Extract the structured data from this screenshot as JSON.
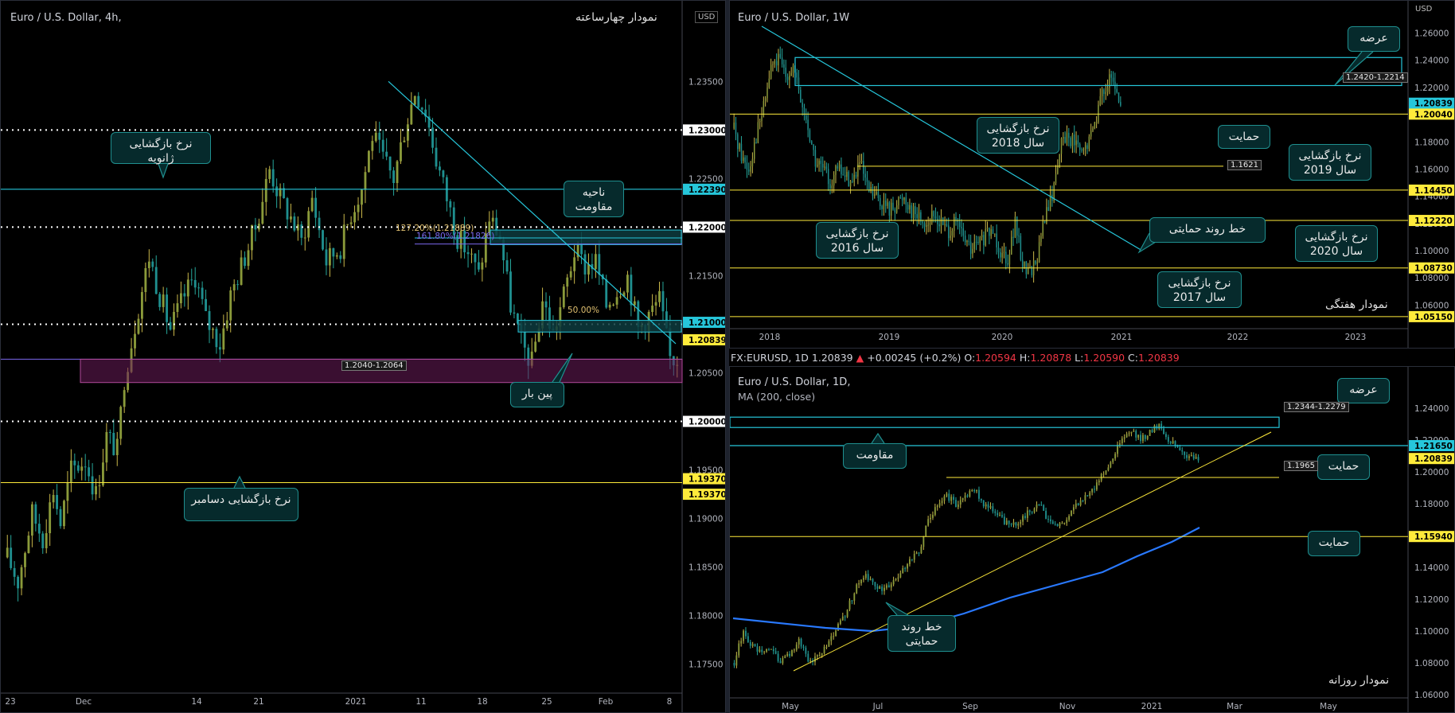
{
  "topbar": {
    "symbol": "FX:EURUSD, 1D",
    "last": "1.20839",
    "arrow": "▲",
    "change": "+0.00245 (+0.2%)",
    "open_label": "O:",
    "open": "1.20594",
    "high_label": "H:",
    "high": "1.20878",
    "low_label": "L:",
    "low": "1.20590",
    "close_label": "C:",
    "close": "1.20839"
  },
  "chart_data": [
    {
      "id": "h4",
      "type": "candlestick",
      "title": "Euro / U.S. Dollar, 4h,",
      "panel_tag": "نمودار چهارساعته",
      "currency": "USD",
      "ylim": [
        1.1735,
        1.2415
      ],
      "y_ticks": [
        "1.17500",
        "1.18000",
        "1.18500",
        "1.19000",
        "1.19500",
        "1.20000",
        "1.20500",
        "1.21000",
        "1.21500",
        "1.22000",
        "1.22500",
        "1.23000",
        "1.23500"
      ],
      "x_ticks": [
        "23",
        "Dec",
        "14",
        "21",
        "2021",
        "11",
        "18",
        "25",
        "Feb",
        "8"
      ],
      "candles_path": [
        [
          0,
          1.186
        ],
        [
          3,
          1.1835
        ],
        [
          7,
          1.1905
        ],
        [
          10,
          1.188
        ],
        [
          13,
          1.193
        ],
        [
          15,
          1.1895
        ],
        [
          18,
          1.195
        ],
        [
          22,
          1.196
        ],
        [
          25,
          1.1925
        ],
        [
          28,
          1.1985
        ],
        [
          31,
          1.197
        ],
        [
          33,
          1.2045
        ],
        [
          36,
          1.21
        ],
        [
          40,
          1.217
        ],
        [
          43,
          1.213
        ],
        [
          46,
          1.2095
        ],
        [
          50,
          1.213
        ],
        [
          53,
          1.215
        ],
        [
          56,
          1.2105
        ],
        [
          60,
          1.208
        ],
        [
          63,
          1.213
        ],
        [
          66,
          1.216
        ],
        [
          70,
          1.22
        ],
        [
          74,
          1.226
        ],
        [
          77,
          1.223
        ],
        [
          80,
          1.221
        ],
        [
          83,
          1.2185
        ],
        [
          86,
          1.223
        ],
        [
          90,
          1.2165
        ],
        [
          94,
          1.218
        ],
        [
          97,
          1.2215
        ],
        [
          100,
          1.224
        ],
        [
          103,
          1.2295
        ],
        [
          106,
          1.227
        ],
        [
          109,
          1.225
        ],
        [
          112,
          1.23
        ],
        [
          115,
          1.234
        ],
        [
          118,
          1.232
        ],
        [
          121,
          1.227
        ],
        [
          124,
          1.223
        ],
        [
          127,
          1.219
        ],
        [
          130,
          1.2175
        ],
        [
          133,
          1.215
        ],
        [
          136,
          1.221
        ],
        [
          139,
          1.219
        ],
        [
          142,
          1.212
        ],
        [
          145,
          1.208
        ],
        [
          148,
          1.206
        ],
        [
          151,
          1.2125
        ],
        [
          154,
          1.209
        ],
        [
          157,
          1.213
        ],
        [
          160,
          1.2175
        ],
        [
          163,
          1.216
        ],
        [
          166,
          1.2165
        ],
        [
          169,
          1.212
        ],
        [
          172,
          1.2135
        ],
        [
          175,
          1.215
        ],
        [
          178,
          1.2095
        ],
        [
          181,
          1.211
        ],
        [
          184,
          1.2125
        ],
        [
          187,
          1.2065
        ]
      ],
      "candle_count": 190,
      "levels": [
        {
          "label": "1.23000",
          "y": 1.23,
          "style": "white-dotted"
        },
        {
          "label": "1.22390",
          "y": 1.2239,
          "style": "cyan",
          "tag": "1.22390"
        },
        {
          "label": "1.22000",
          "y": 1.22,
          "style": "white-dotted"
        },
        {
          "label": "1.21000",
          "y": 1.21,
          "style": "white-dotted"
        },
        {
          "label": "1.20000",
          "y": 1.2,
          "style": "white-dotted"
        },
        {
          "label": "1.19370",
          "y": 1.1937,
          "style": "yellow",
          "tag": "1.19370"
        }
      ],
      "price_tags": [
        {
          "text": "1.22390",
          "y": 1.2239,
          "bg": "#26c6da",
          "fg": "#000"
        },
        {
          "text": "1.22000",
          "y": 1.22,
          "bg": "#ffffff",
          "fg": "#000"
        },
        {
          "text": "1.21000",
          "y": 1.2102,
          "bg": "#26c6da",
          "fg": "#000"
        },
        {
          "text": "1.20839",
          "y": 1.2084,
          "bg": "#ffeb3b",
          "fg": "#000"
        },
        {
          "text": "1.23000",
          "y": 1.23,
          "bg": "#ffffff",
          "fg": "#000"
        },
        {
          "text": "1.20000",
          "y": 1.2,
          "bg": "#ffffff",
          "fg": "#000"
        },
        {
          "text": "1.19370",
          "y": 1.1941,
          "bg": "#ffeb3b",
          "fg": "#000"
        },
        {
          "text": "1.19370",
          "y": 1.1925,
          "bg": "#ffeb3b",
          "fg": "#000"
        }
      ],
      "zone": {
        "label": "1.2040-1.2064",
        "low": 1.204,
        "high": 1.2064
      },
      "fib_labels": [
        "127.20%(1.21889)",
        "161.80%(1.21826)",
        "50.00%"
      ],
      "callouts": [
        {
          "text": "نرخ بازگشایی ژانویه"
        },
        {
          "text": "ناحیه\nمقاومت"
        },
        {
          "text": "پین بار"
        },
        {
          "text": "نرخ بازگشایی دسامبر"
        }
      ]
    },
    {
      "id": "w1",
      "type": "candlestick",
      "title": "Euro / U.S. Dollar, 1W",
      "panel_tag": "نمودار هفتگی",
      "currency": "USD",
      "ylim": [
        1.045,
        1.272
      ],
      "y_ticks": [
        "1.06000",
        "1.08000",
        "1.10000",
        "1.12000",
        "1.14000",
        "1.16000",
        "1.18000",
        "1.20000",
        "1.22000",
        "1.24000",
        "1.26000"
      ],
      "x_ticks": [
        "2018",
        "2019",
        "2020",
        "2021",
        "2022",
        "2023"
      ],
      "candles_path": [
        [
          0,
          1.19
        ],
        [
          4,
          1.17
        ],
        [
          8,
          1.16
        ],
        [
          12,
          1.185
        ],
        [
          16,
          1.205
        ],
        [
          20,
          1.235
        ],
        [
          24,
          1.24
        ],
        [
          28,
          1.23
        ],
        [
          32,
          1.235
        ],
        [
          36,
          1.21
        ],
        [
          40,
          1.19
        ],
        [
          44,
          1.165
        ],
        [
          48,
          1.16
        ],
        [
          52,
          1.15
        ],
        [
          56,
          1.16
        ],
        [
          60,
          1.155
        ],
        [
          64,
          1.15
        ],
        [
          68,
          1.165
        ],
        [
          72,
          1.145
        ],
        [
          76,
          1.14
        ],
        [
          80,
          1.135
        ],
        [
          84,
          1.13
        ],
        [
          88,
          1.135
        ],
        [
          92,
          1.14
        ],
        [
          96,
          1.13
        ],
        [
          100,
          1.125
        ],
        [
          104,
          1.12
        ],
        [
          108,
          1.125
        ],
        [
          112,
          1.12
        ],
        [
          116,
          1.115
        ],
        [
          120,
          1.12
        ],
        [
          124,
          1.11
        ],
        [
          128,
          1.1
        ],
        [
          132,
          1.105
        ],
        [
          136,
          1.11
        ],
        [
          140,
          1.115
        ],
        [
          144,
          1.1
        ],
        [
          148,
          1.095
        ],
        [
          152,
          1.12
        ],
        [
          156,
          1.09
        ],
        [
          160,
          1.085
        ],
        [
          164,
          1.095
        ],
        [
          168,
          1.125
        ],
        [
          172,
          1.14
        ],
        [
          176,
          1.175
        ],
        [
          180,
          1.185
        ],
        [
          184,
          1.18
        ],
        [
          188,
          1.17
        ],
        [
          192,
          1.18
        ],
        [
          196,
          1.2
        ],
        [
          200,
          1.22
        ],
        [
          204,
          1.225
        ],
        [
          208,
          1.21
        ]
      ],
      "candle_count": 210,
      "levels": [
        {
          "label": "1.20040",
          "y": 1.2004
        },
        {
          "label": "1.14450",
          "y": 1.1445
        },
        {
          "label": "1.12220",
          "y": 1.1222
        },
        {
          "label": "1.08730",
          "y": 1.0873
        },
        {
          "label": "1.05150",
          "y": 1.0515
        }
      ],
      "price_tags": [
        {
          "text": "1.20839",
          "y": 1.2084,
          "bg": "#26c6da",
          "fg": "#000"
        },
        {
          "text": "1.20040",
          "y": 1.2004,
          "bg": "#ffeb3b",
          "fg": "#000"
        },
        {
          "text": "1.14450",
          "y": 1.1445,
          "bg": "#ffeb3b",
          "fg": "#000"
        },
        {
          "text": "1.12220",
          "y": 1.1222,
          "bg": "#ffeb3b",
          "fg": "#000"
        },
        {
          "text": "1.08730",
          "y": 1.0873,
          "bg": "#ffeb3b",
          "fg": "#000"
        },
        {
          "text": "1.05150",
          "y": 1.0515,
          "bg": "#ffeb3b",
          "fg": "#000"
        }
      ],
      "zone": {
        "label": "1.2420-1.2214",
        "low": 1.2214,
        "high": 1.242
      },
      "support_label": "1.1621",
      "callouts": [
        {
          "text": "عرضه"
        },
        {
          "text": "نرخ بازگشایی\nسال 2018"
        },
        {
          "text": "حمایت"
        },
        {
          "text": "نرخ بازگشایی\nسال 2019"
        },
        {
          "text": "نرخ بازگشایی\nسال 2016"
        },
        {
          "text": "خط روند حمایتی"
        },
        {
          "text": "نرخ بازگشایی\nسال 2020"
        },
        {
          "text": "نرخ بازگشایی\nسال 2017"
        }
      ]
    },
    {
      "id": "d1",
      "type": "candlestick",
      "title": "Euro / U.S. Dollar, 1D,",
      "subtitle": "MA (200, close)",
      "panel_tag": "نمودار روزانه",
      "ylim": [
        1.056,
        1.256
      ],
      "y_ticks": [
        "1.06000",
        "1.08000",
        "1.10000",
        "1.12000",
        "1.14000",
        "1.16000",
        "1.18000",
        "1.20000",
        "1.22000",
        "1.24000"
      ],
      "x_ticks": [
        "May",
        "Jul",
        "Sep",
        "Nov",
        "2021",
        "Mar",
        "May"
      ],
      "candles_path": [
        [
          0,
          1.08
        ],
        [
          4,
          1.1
        ],
        [
          8,
          1.09
        ],
        [
          12,
          1.085
        ],
        [
          16,
          1.09
        ],
        [
          20,
          1.08
        ],
        [
          24,
          1.085
        ],
        [
          28,
          1.095
        ],
        [
          32,
          1.08
        ],
        [
          36,
          1.085
        ],
        [
          40,
          1.09
        ],
        [
          44,
          1.1
        ],
        [
          48,
          1.11
        ],
        [
          52,
          1.125
        ],
        [
          56,
          1.135
        ],
        [
          60,
          1.13
        ],
        [
          64,
          1.125
        ],
        [
          68,
          1.13
        ],
        [
          72,
          1.135
        ],
        [
          76,
          1.145
        ],
        [
          80,
          1.15
        ],
        [
          84,
          1.17
        ],
        [
          88,
          1.18
        ],
        [
          92,
          1.185
        ],
        [
          96,
          1.18
        ],
        [
          100,
          1.185
        ],
        [
          104,
          1.19
        ],
        [
          108,
          1.18
        ],
        [
          112,
          1.175
        ],
        [
          116,
          1.17
        ],
        [
          120,
          1.165
        ],
        [
          124,
          1.17
        ],
        [
          128,
          1.175
        ],
        [
          132,
          1.18
        ],
        [
          136,
          1.17
        ],
        [
          140,
          1.165
        ],
        [
          144,
          1.17
        ],
        [
          148,
          1.18
        ],
        [
          152,
          1.185
        ],
        [
          156,
          1.19
        ],
        [
          160,
          1.2
        ],
        [
          164,
          1.21
        ],
        [
          168,
          1.22
        ],
        [
          172,
          1.225
        ],
        [
          176,
          1.22
        ],
        [
          180,
          1.225
        ],
        [
          184,
          1.23
        ],
        [
          188,
          1.22
        ],
        [
          192,
          1.215
        ],
        [
          196,
          1.21
        ],
        [
          200,
          1.208
        ]
      ],
      "candle_count": 202,
      "ma_path": [
        [
          0,
          1.108
        ],
        [
          40,
          1.102
        ],
        [
          60,
          1.1
        ],
        [
          80,
          1.103
        ],
        [
          100,
          1.111
        ],
        [
          120,
          1.121
        ],
        [
          140,
          1.129
        ],
        [
          160,
          1.137
        ],
        [
          175,
          1.147
        ],
        [
          190,
          1.156
        ],
        [
          202,
          1.165
        ]
      ],
      "levels": [
        {
          "label": "1.21650",
          "y": 1.2165
        },
        {
          "label": "1.15940",
          "y": 1.1594
        }
      ],
      "price_tags": [
        {
          "text": "1.21650",
          "y": 1.2165,
          "bg": "#26c6da",
          "fg": "#000"
        },
        {
          "text": "1.20839",
          "y": 1.2084,
          "bg": "#ffeb3b",
          "fg": "#000"
        },
        {
          "text": "1.15940",
          "y": 1.1594,
          "bg": "#ffeb3b",
          "fg": "#000"
        }
      ],
      "zone": {
        "label": "1.2344-1.2279",
        "low": 1.2279,
        "high": 1.2344
      },
      "support_label": "1.1965",
      "callouts": [
        {
          "text": "عرضه"
        },
        {
          "text": "مقاومت"
        },
        {
          "text": "حمایت"
        },
        {
          "text": "حمایت"
        },
        {
          "text": "خط روند\nحمایتی"
        }
      ]
    }
  ]
}
